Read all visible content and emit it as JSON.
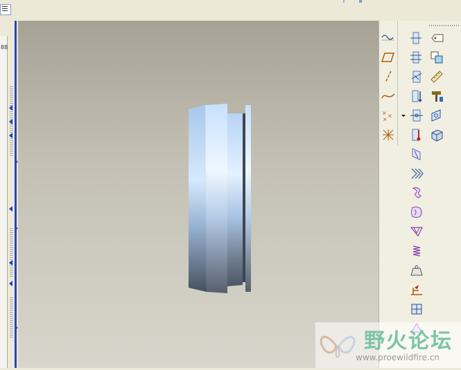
{
  "topbar": {
    "menu_button_icon": "list-icon"
  },
  "left_panel": {
    "label": "88"
  },
  "viewport": {
    "model": "cylindrical-part-side-view",
    "colors": {
      "highlight": "#e4f1ff",
      "mid": "#a9c3e3",
      "shadow": "#4c5766"
    }
  },
  "toolbar": {
    "col1": [
      "curve-icon",
      "plane-icon",
      "axis-icon",
      "sketch-curve-icon",
      "point-icon",
      "csys-icon"
    ],
    "col2": [
      "mirror-icon",
      "pattern-icon",
      "cut-icon",
      "extrude-icon",
      "hole-icon",
      "thermal-icon",
      "rib-icon",
      "rib-array-icon",
      "draft-icon",
      "shell-icon",
      "truss-icon",
      "spring-icon",
      "weight-icon",
      "weld-icon",
      "frame-icon",
      "sweep-icon"
    ],
    "col3": [
      "tag-icon",
      "copy-icon",
      "ruler-icon",
      "hammer-icon",
      "surface-icon",
      "cube-icon"
    ]
  },
  "watermark": {
    "title": "野火论坛",
    "url": "www.proewildfire.cn"
  }
}
